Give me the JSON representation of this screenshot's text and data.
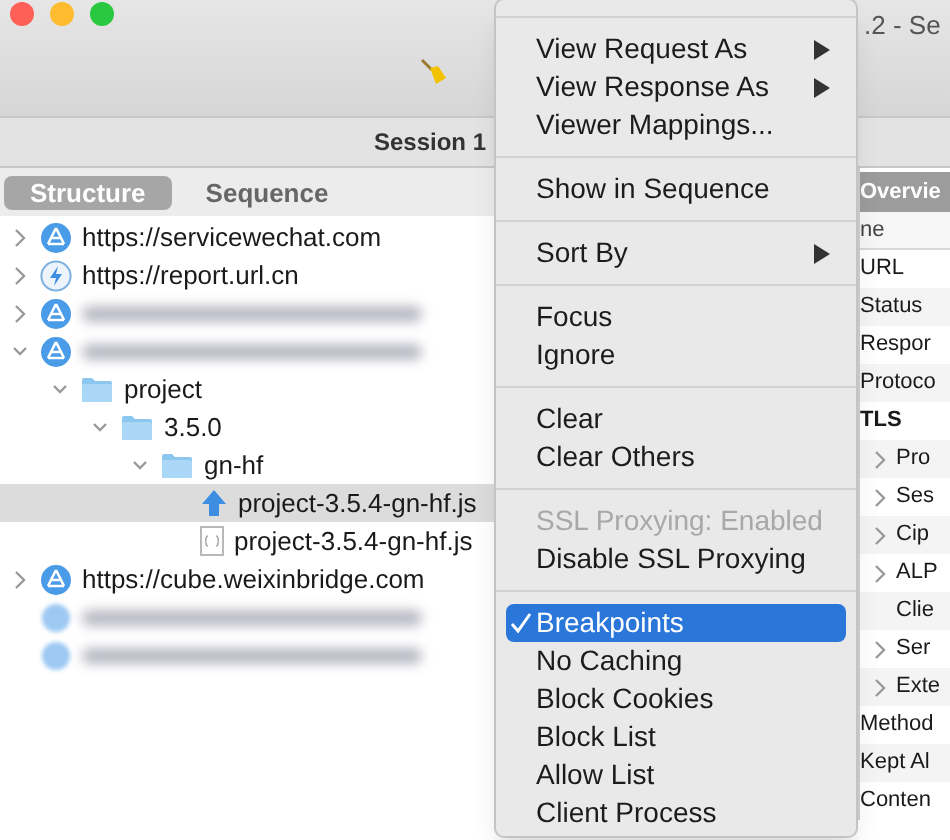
{
  "window": {
    "title": ".2 - Se"
  },
  "session_tab": {
    "label": "Session 1"
  },
  "view_tabs": [
    {
      "label": "Structure",
      "selected": true
    },
    {
      "label": "Sequence",
      "selected": false
    }
  ],
  "tree": [
    {
      "kind": "host",
      "label": "https://servicewechat.com",
      "expanded": false,
      "selected": false
    },
    {
      "kind": "lightning",
      "label": "https://report.url.cn",
      "expanded": false,
      "selected": false
    },
    {
      "kind": "host",
      "blurred": true,
      "expanded": false,
      "selected": false
    },
    {
      "kind": "host",
      "blurred": true,
      "expanded": true,
      "selected": false,
      "children": [
        {
          "kind": "folder",
          "label": "project",
          "expanded": true,
          "selected": false,
          "children": [
            {
              "kind": "folder",
              "label": "3.5.0",
              "expanded": true,
              "selected": false,
              "children": [
                {
                  "kind": "folder",
                  "label": "gn-hf",
                  "expanded": true,
                  "selected": false,
                  "children": [
                    {
                      "kind": "upload",
                      "label": "project-3.5.4-gn-hf.js",
                      "selected": true
                    },
                    {
                      "kind": "script",
                      "label": "project-3.5.4-gn-hf.js",
                      "selected": false
                    }
                  ]
                }
              ]
            }
          ]
        }
      ]
    },
    {
      "kind": "host",
      "label": "https://cube.weixinbridge.com",
      "expanded": false,
      "selected": false
    },
    {
      "kind": "faded",
      "blurred": true,
      "selected": false
    },
    {
      "kind": "faded",
      "blurred": true,
      "selected": false
    }
  ],
  "overview": {
    "header": "Overvie",
    "column": "ne",
    "rows": [
      {
        "label": "URL",
        "kind": "field"
      },
      {
        "label": "Status",
        "kind": "field"
      },
      {
        "label": "Respor",
        "kind": "field"
      },
      {
        "label": "Protoco",
        "kind": "field"
      },
      {
        "label": "TLS",
        "kind": "section"
      },
      {
        "label": "Pro",
        "kind": "child",
        "expanded": false
      },
      {
        "label": "Ses",
        "kind": "child",
        "expanded": false
      },
      {
        "label": "Cip",
        "kind": "child",
        "expanded": false
      },
      {
        "label": "ALP",
        "kind": "child",
        "expanded": false
      },
      {
        "label": "Clie",
        "kind": "leaf"
      },
      {
        "label": "Ser",
        "kind": "child",
        "expanded": false
      },
      {
        "label": "Exte",
        "kind": "child",
        "expanded": false
      },
      {
        "label": "Method",
        "kind": "field"
      },
      {
        "label": "Kept Al",
        "kind": "field"
      },
      {
        "label": "Conten",
        "kind": "field"
      }
    ]
  },
  "context_menu": {
    "groups": [
      [
        {
          "label": "View Request As",
          "submenu": true
        },
        {
          "label": "View Response As",
          "submenu": true
        },
        {
          "label": "Viewer Mappings..."
        }
      ],
      [
        {
          "label": "Show in Sequence"
        }
      ],
      [
        {
          "label": "Sort By",
          "submenu": true
        }
      ],
      [
        {
          "label": "Focus"
        },
        {
          "label": "Ignore"
        }
      ],
      [
        {
          "label": "Clear"
        },
        {
          "label": "Clear Others"
        }
      ],
      [
        {
          "label": "SSL Proxying: Enabled",
          "disabled": true
        },
        {
          "label": "Disable SSL Proxying"
        }
      ],
      [
        {
          "label": "Breakpoints",
          "checked": true,
          "selected": true
        },
        {
          "label": "No Caching",
          "checked": false
        },
        {
          "label": "Block Cookies",
          "checked": false
        },
        {
          "label": "Block List",
          "checked": false
        },
        {
          "label": "Allow List",
          "checked": false
        },
        {
          "label": "Client Process",
          "checked": false
        }
      ]
    ]
  }
}
